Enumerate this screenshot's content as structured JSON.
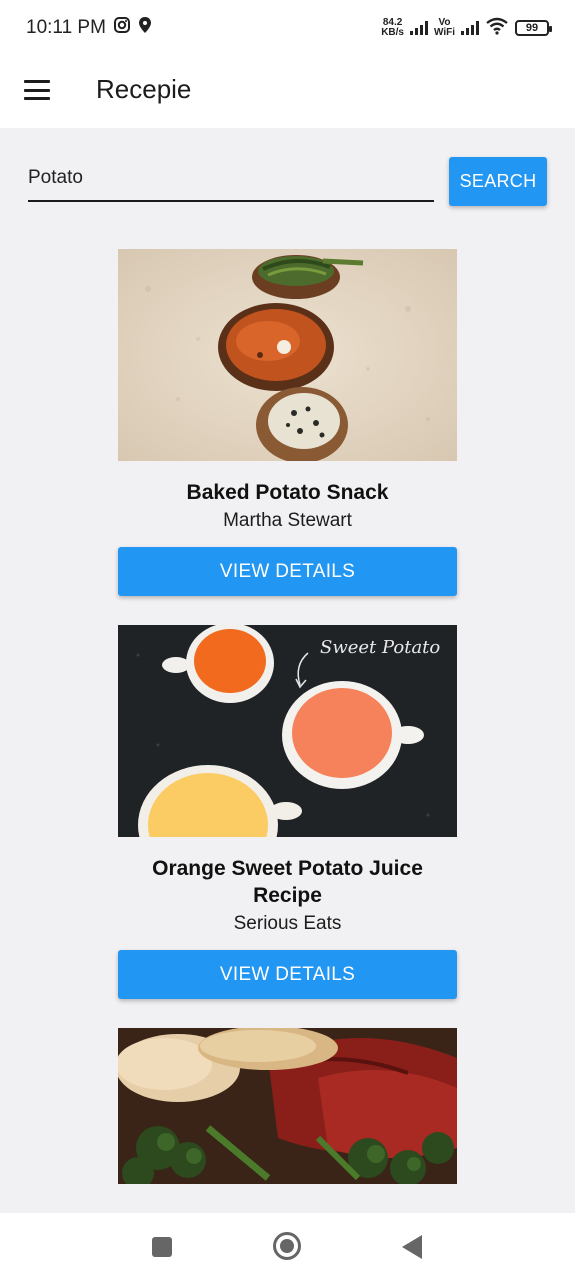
{
  "status_bar": {
    "time": "10:11 PM",
    "net_speed_value": "84.2",
    "net_speed_unit": "KB/s",
    "volte_top": "Vo",
    "volte_bottom": "WiFi",
    "battery": "99"
  },
  "app_bar": {
    "title": "Recepie"
  },
  "search": {
    "value": "Potato",
    "button_label": "SEARCH"
  },
  "recipes": [
    {
      "title": "Baked Potato Snack",
      "source": "Martha Stewart",
      "button_label": "VIEW DETAILS"
    },
    {
      "title": "Orange Sweet Potato Juice Recipe",
      "source": "Serious Eats",
      "button_label": "VIEW DETAILS"
    }
  ],
  "images": {
    "card2_handwriting": "Sweet Potato"
  },
  "colors": {
    "accent": "#2196f3",
    "background": "#f1f0f2",
    "bar": "#ffffff"
  }
}
